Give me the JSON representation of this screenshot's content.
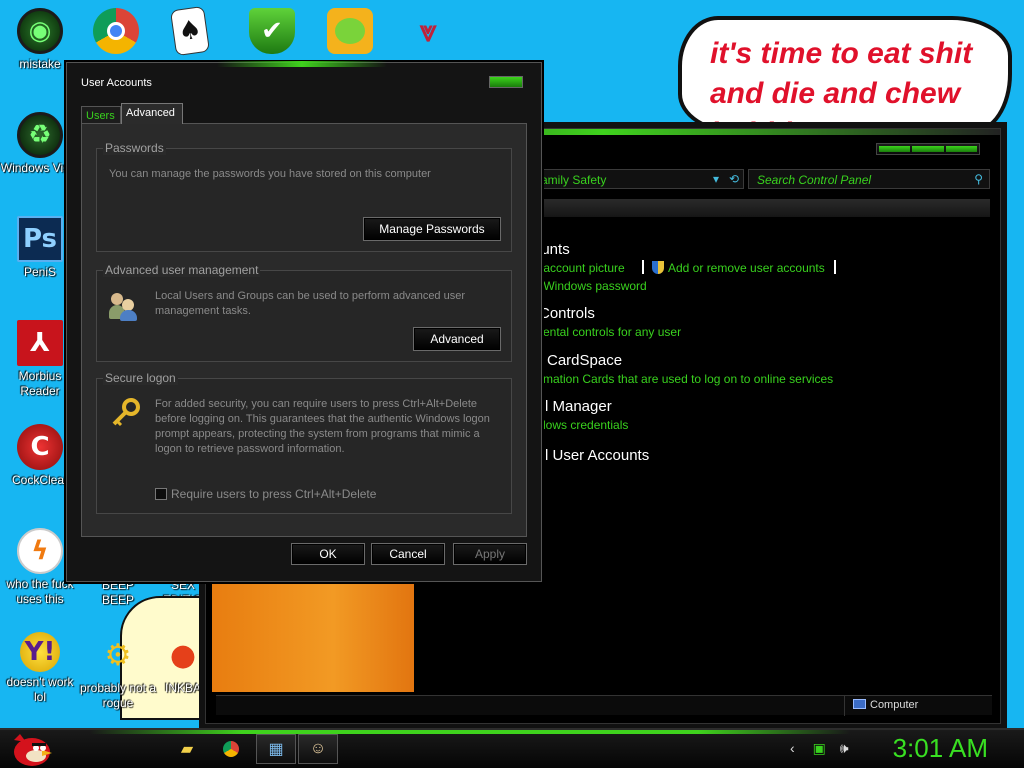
{
  "desktop": {
    "icons": [
      {
        "label": "mistake",
        "icon": "green-orb-icon"
      },
      {
        "label": "",
        "icon": "chrome-icon"
      },
      {
        "label": "",
        "icon": "solitaire-icon"
      },
      {
        "label": "",
        "icon": "green-shield-icon"
      },
      {
        "label": "",
        "icon": "bad-piggies-icon"
      },
      {
        "label": "",
        "icon": "winged-logo-icon"
      },
      {
        "label": "Windows Vista",
        "icon": "recycle-bin-icon"
      },
      {
        "label": "PeniS",
        "icon": "photoshop-icon"
      },
      {
        "label": "Morbius Reader",
        "icon": "pdf-reader-icon"
      },
      {
        "label": "CockClear",
        "icon": "ccleaner-icon"
      },
      {
        "label": "who the fuck uses this",
        "icon": "winamp-icon"
      },
      {
        "label": "BEEP BEEP",
        "icon": ""
      },
      {
        "label": "SEX EDITIO",
        "icon": ""
      },
      {
        "label": "doesn't work lol",
        "icon": "yahoo-messenger-icon"
      },
      {
        "label": "probably not a rogue",
        "icon": "gears-icon"
      },
      {
        "label": "INKBA",
        "icon": "ink-icon"
      }
    ],
    "speech_bubble_lines": [
      "it's time to eat shit",
      "and die and chew",
      "bubble gum"
    ]
  },
  "dialog": {
    "title": "User Accounts",
    "tabs": [
      "Users",
      "Advanced"
    ],
    "active_tab": "Advanced",
    "passwords": {
      "heading": "Passwords",
      "text": "You can manage the passwords you have stored on this computer",
      "button": "Manage Passwords"
    },
    "advanced_mgmt": {
      "heading": "Advanced user management",
      "text": "Local Users and Groups can be used to perform advanced user management tasks.",
      "button": "Advanced"
    },
    "secure_logon": {
      "heading": "Secure logon",
      "text": "For added security, you can require users to press Ctrl+Alt+Delete before logging on. This guarantees that the authentic Windows logon prompt appears, protecting the system from programs that mimic a logon to retrieve password information.",
      "checkbox": "Require users to press Ctrl+Alt+Delete",
      "checked": false
    },
    "buttons": {
      "ok": "OK",
      "cancel": "Cancel",
      "apply": "Apply"
    }
  },
  "control_panel": {
    "address": "amily Safety",
    "search_placeholder": "Search Control Panel",
    "sections": [
      {
        "heading": "ounts",
        "links": [
          "r account picture",
          "Add or remove user accounts",
          "r Windows password"
        ]
      },
      {
        "heading": "Controls",
        "links": [
          "rental controls for any user"
        ]
      },
      {
        "heading": "CardSpace",
        "links": [
          "rmation Cards that are used to log on to online services"
        ]
      },
      {
        "heading": "l Manager",
        "links": [
          "dows credentials"
        ]
      },
      {
        "heading": "l User Accounts",
        "links": []
      }
    ],
    "status": "Computer"
  },
  "taskbar": {
    "clock": "3:01 AM",
    "accent": "#39e022"
  },
  "colors": {
    "desktop": "#17b6f2",
    "accent_green": "#39d11e",
    "bubble_text": "#e0112b"
  }
}
